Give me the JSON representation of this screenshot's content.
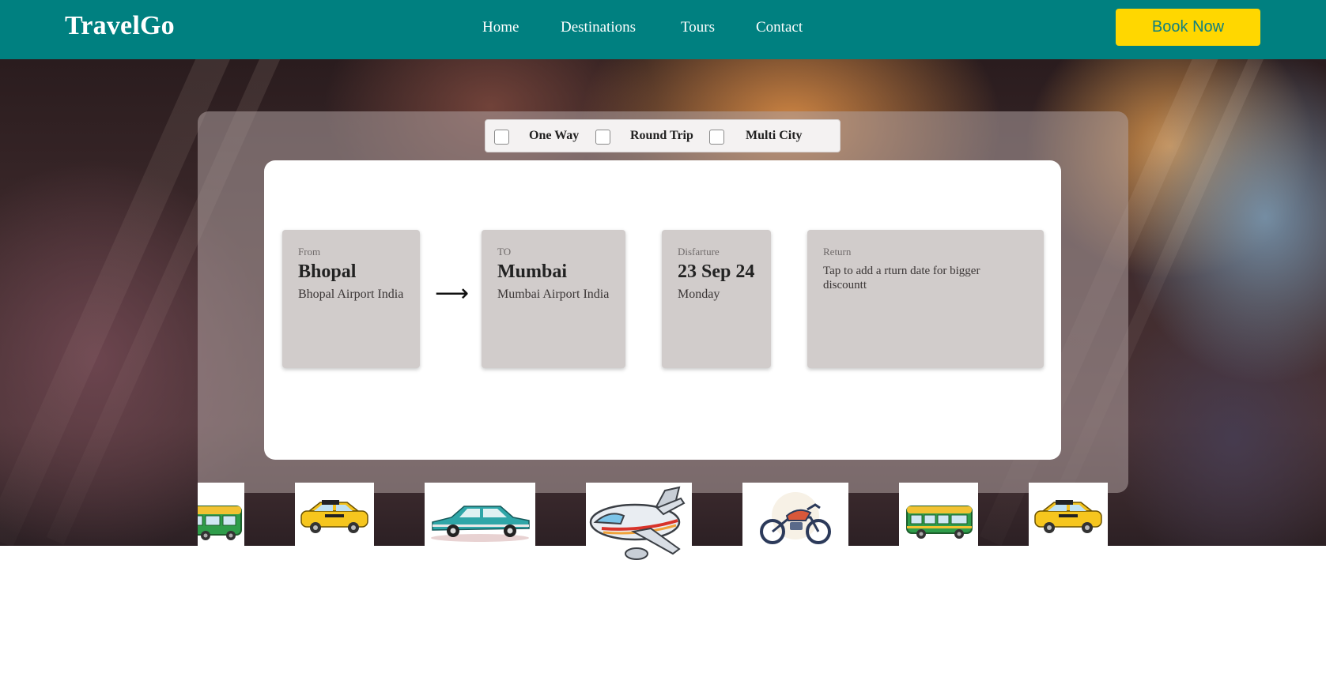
{
  "header": {
    "logo": "TravelGo",
    "nav": [
      "Home",
      "Destinations",
      "Tours",
      "Contact"
    ],
    "cta": "Book Now",
    "colors": {
      "background": "#008080",
      "cta": "#ffd700",
      "cta_text": "#11807f"
    }
  },
  "trip_types": [
    {
      "label": "One Way",
      "checked": false
    },
    {
      "label": "Round Trip",
      "checked": false
    },
    {
      "label": "Multi City",
      "checked": false
    }
  ],
  "search": {
    "from": {
      "caption": "From",
      "city": "Bhopal",
      "airport": "Bhopal Airport India"
    },
    "to": {
      "caption": "TO",
      "city": "Mumbai",
      "airport": "Mumbai Airport India"
    },
    "departure": {
      "caption": "Disfarture",
      "date": "23 Sep 24",
      "day": "Monday"
    },
    "return": {
      "caption": "Return",
      "hint": "Tap to add a rturn date for bigger discountt"
    },
    "swap_icon": "arrow-right-icon"
  },
  "vehicles": [
    "bus-icon",
    "taxi-icon",
    "vintage-car-icon",
    "airplane-icon",
    "motorcycle-icon",
    "bus-icon",
    "taxi-icon"
  ]
}
